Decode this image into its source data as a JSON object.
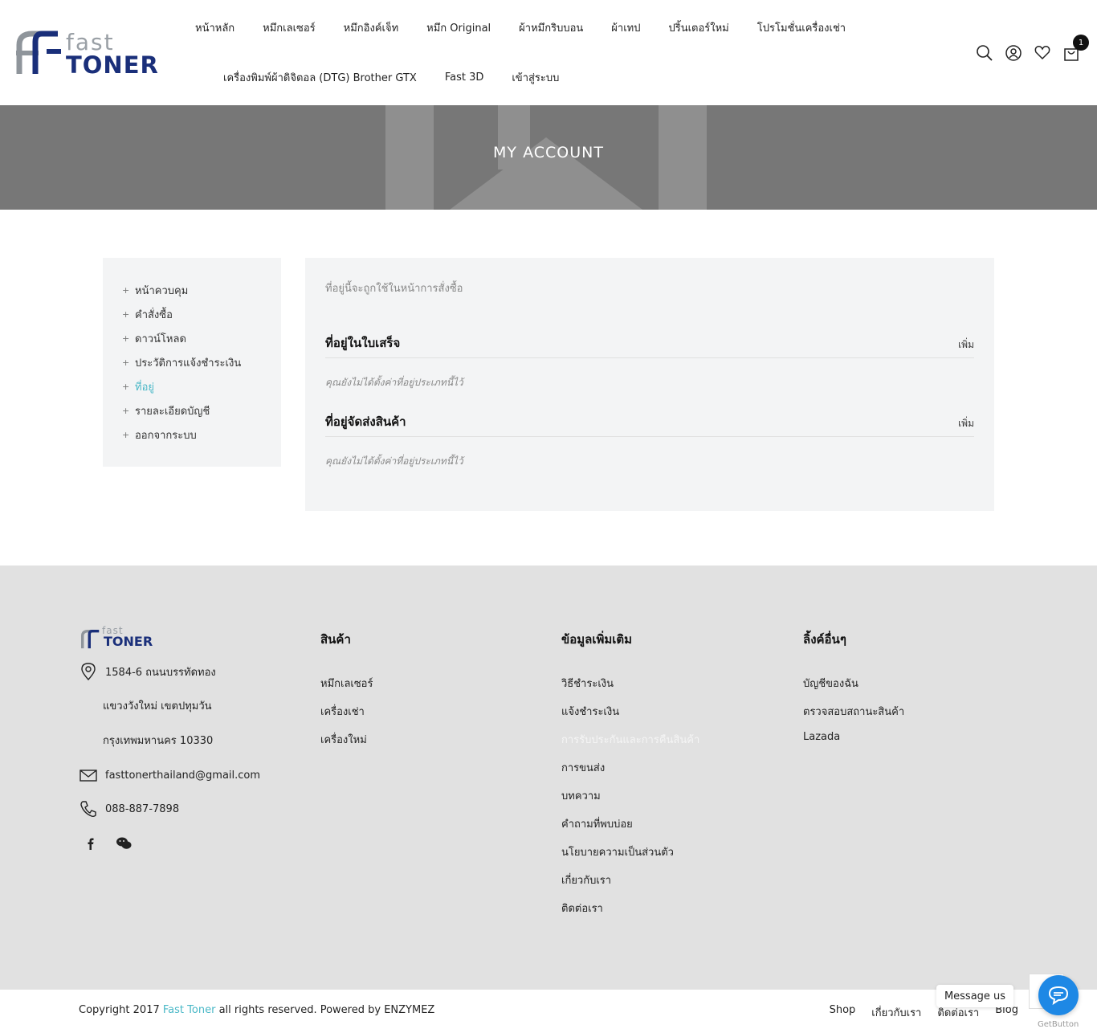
{
  "header": {
    "logo_top": "fast",
    "logo_bottom": "TONER",
    "nav_row1": [
      "หน้าหลัก",
      "หมึกเลเซอร์",
      "หมึกอิงค์เจ็ท",
      "หมึก Original",
      "ผ้าหมึกริบบอน",
      "ผ้าเทป",
      "ปริ้นเตอร์ใหม่",
      "โปรโมชั่นเครื่องเช่า"
    ],
    "nav_row2": [
      "เครื่องพิมพ์ผ้าดิจิตอล (DTG) Brother GTX",
      "Fast 3D",
      "เข้าสู่ระบบ"
    ],
    "cart_count": "1",
    "icons": [
      "search-icon",
      "user-icon",
      "heart-icon",
      "cart-icon"
    ]
  },
  "banner": {
    "title": "MY ACCOUNT"
  },
  "sidebar": {
    "items": [
      {
        "label": "หน้าควบคุม",
        "active": false
      },
      {
        "label": "คำสั่งซื้อ",
        "active": false
      },
      {
        "label": "ดาวน์โหลด",
        "active": false
      },
      {
        "label": "ประวัติการแจ้งชำระเงิน",
        "active": false
      },
      {
        "label": "ที่อยู่",
        "active": true
      },
      {
        "label": "รายละเอียดบัญชี",
        "active": false
      },
      {
        "label": "ออกจากระบบ",
        "active": false
      }
    ]
  },
  "main": {
    "intro": "ที่อยู่นี้จะถูกใช้ในหน้าการสั่งซื้อ",
    "billing": {
      "title": "ที่อยู่ในใบเสร็จ",
      "add": "เพิ่ม",
      "note": "คุณยังไม่ได้ตั้งค่าที่อยู่ประเภทนี้ไว้"
    },
    "shipping": {
      "title": "ที่อยู่จัดส่งสินค้า",
      "add": "เพิ่ม",
      "note": "คุณยังไม่ได้ตั้งค่าที่อยู่ประเภทนี้ไว้"
    }
  },
  "footer": {
    "logo_top": "fast",
    "logo_bottom": "TONER",
    "address1": "1584-6 ถนนบรรทัดทอง",
    "address2": "แขวงวังใหม่ เขตปทุมวัน",
    "address3": "กรุงเทพมหานคร 10330",
    "email": "fasttonerthailand@gmail.com",
    "phone": "088-887-7898",
    "col1": {
      "title": "สินค้า",
      "links": [
        "หมึกเลเซอร์",
        "เครื่องเช่า",
        "เครื่องใหม่"
      ]
    },
    "col2": {
      "title": "ข้อมูลเพิ่มเติม",
      "links": [
        "วิธีชำระเงิน",
        "แจ้งชำระเงิน",
        "การรับประกันและการคืนสินค้า",
        "การขนส่ง",
        "บทความ",
        "คำถามที่พบบ่อย",
        "นโยบายความเป็นส่วนตัว",
        "เกี่ยวกับเรา",
        "ติดต่อเรา"
      ]
    },
    "col3": {
      "title": "ลิ้งค์อื่นๆ",
      "links": [
        "บัญชีของฉัน",
        "ตรวจสอบสถานะสินค้า",
        "Lazada"
      ]
    }
  },
  "bottom": {
    "copy_pre": "Copyright 2017",
    "copy_brand": "Fast Toner",
    "copy_post": "all rights reserved. Powered by ENZYMEZ",
    "links": [
      "Shop",
      "เกี่ยวกับเรา",
      "ติดต่อเรา",
      "Blog"
    ]
  },
  "widget": {
    "message": "Message us",
    "brand": "GetButton"
  },
  "colors": {
    "accent": "#4ab8c7",
    "brand_blue": "#1a2f7a",
    "banner": "#777777",
    "footer_bg": "#e1e1e1",
    "chat": "#1e88e5"
  }
}
